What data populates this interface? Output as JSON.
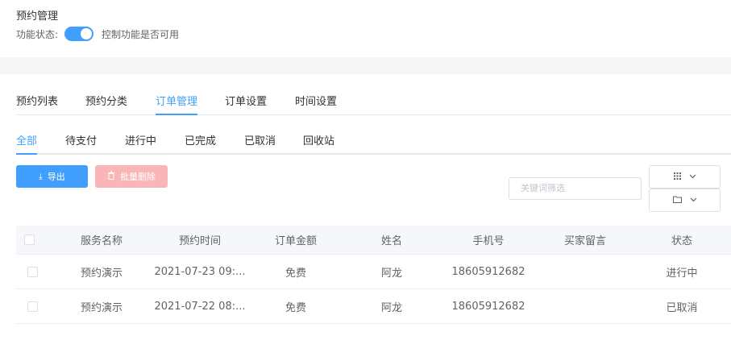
{
  "header": {
    "title": "预约管理",
    "status_label": "功能状态:",
    "switch_on": true,
    "status_desc": "控制功能是否可用"
  },
  "tabs": [
    {
      "label": "预约列表",
      "active": false
    },
    {
      "label": "预约分类",
      "active": false
    },
    {
      "label": "订单管理",
      "active": true
    },
    {
      "label": "订单设置",
      "active": false
    },
    {
      "label": "时间设置",
      "active": false
    }
  ],
  "subtabs": [
    {
      "label": "全部",
      "active": true
    },
    {
      "label": "待支付",
      "active": false
    },
    {
      "label": "进行中",
      "active": false
    },
    {
      "label": "已完成",
      "active": false
    },
    {
      "label": "已取消",
      "active": false
    },
    {
      "label": "回收站",
      "active": false
    }
  ],
  "toolbar": {
    "export_label": "导出",
    "batch_delete_label": "批量删除",
    "search_placeholder": "关键词筛选"
  },
  "table": {
    "columns": [
      "服务名称",
      "预约时间",
      "订单金额",
      "姓名",
      "手机号",
      "买家留言",
      "状态"
    ],
    "rows": [
      [
        "预约演示",
        "2021-07-23 09:...",
        "免费",
        "阿龙",
        "18605912682",
        "",
        "进行中"
      ],
      [
        "预约演示",
        "2021-07-22 08:...",
        "免费",
        "阿龙",
        "18605912682",
        "",
        "已取消"
      ]
    ]
  },
  "colors": {
    "accent": "#409eff",
    "danger_disabled": "#fab6b6"
  }
}
